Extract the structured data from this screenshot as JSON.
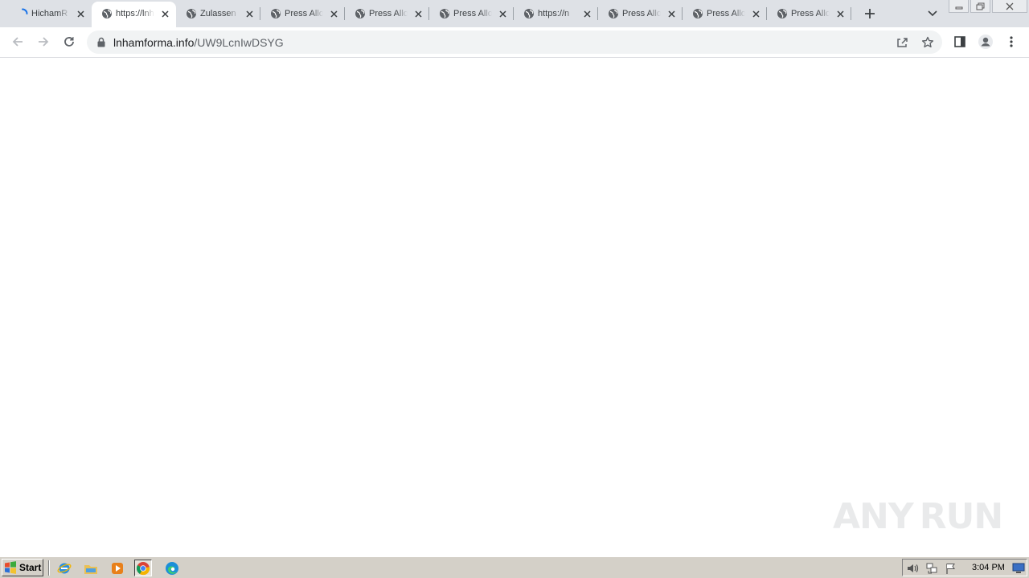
{
  "browser": {
    "tabs": [
      {
        "title": "HichamR",
        "favicon": "loading-spinner-icon",
        "active": false
      },
      {
        "title": "https://lnhamforma.info",
        "favicon": "globe-icon",
        "active": true
      },
      {
        "title": "Zulassen",
        "favicon": "globe-icon",
        "active": false
      },
      {
        "title": "Press Allow",
        "favicon": "globe-icon",
        "active": false
      },
      {
        "title": "Press Allow",
        "favicon": "globe-icon",
        "active": false
      },
      {
        "title": "Press Allow",
        "favicon": "globe-icon",
        "active": false
      },
      {
        "title": "https://n",
        "favicon": "globe-icon",
        "active": false
      },
      {
        "title": "Press Allow",
        "favicon": "globe-icon",
        "active": false
      },
      {
        "title": "Press Allow",
        "favicon": "globe-icon",
        "active": false
      },
      {
        "title": "Press Allow",
        "favicon": "globe-icon",
        "active": false
      }
    ],
    "address": {
      "host": "lnhamforma.info",
      "path": "/UW9LcnIwDSYG"
    },
    "colors": {
      "tabstrip": "#dee1e6",
      "omnibox": "#f1f3f4",
      "accent_loading": "#1a73e8"
    }
  },
  "watermark": {
    "left": "ANY",
    "right": "RUN"
  },
  "taskbar": {
    "start_label": "Start",
    "pinned": [
      "internet-explorer-icon",
      "file-explorer-icon",
      "media-player-icon",
      "chrome-icon",
      "edge-icon"
    ],
    "tray_icons": [
      "volume-icon",
      "network-icon",
      "action-center-flag-icon"
    ],
    "clock": "3:04 PM"
  }
}
